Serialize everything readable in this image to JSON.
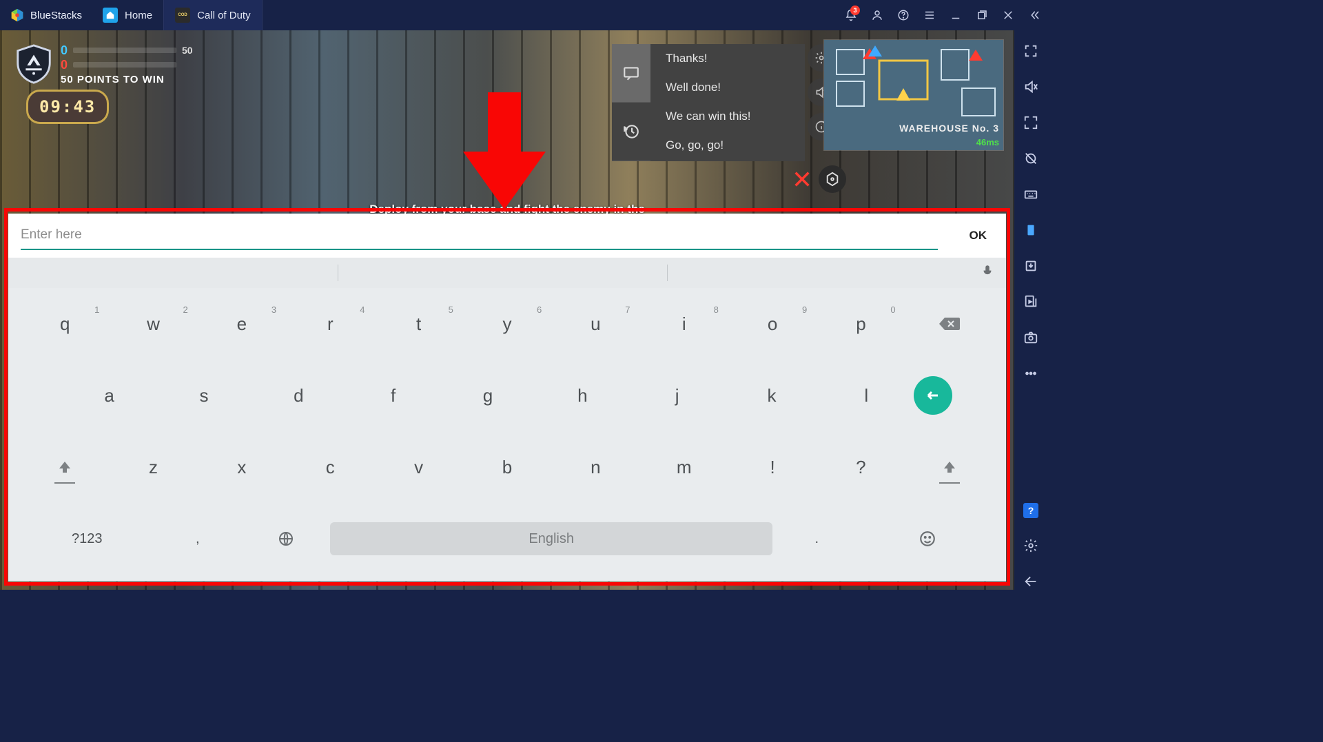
{
  "brand": "BlueStacks",
  "tabs": {
    "home": "Home",
    "cod": "Call of Duty"
  },
  "notif_count": "3",
  "hud": {
    "score_blue": "0",
    "score_red": "0",
    "target": "50",
    "objective": "50 POINTS TO WIN",
    "timer": "09:43",
    "deploy_hint": "Deploy from your base and fight the enemy in the",
    "map_location": "WAREHOUSE No. 3",
    "ping": "46ms"
  },
  "quickchat": [
    "Thanks!",
    "Well done!",
    "We can win this!",
    "Go, go, go!"
  ],
  "input": {
    "placeholder": "Enter here",
    "ok": "OK"
  },
  "keyboard": {
    "row1": [
      {
        "k": "q",
        "h": "1"
      },
      {
        "k": "w",
        "h": "2"
      },
      {
        "k": "e",
        "h": "3"
      },
      {
        "k": "r",
        "h": "4"
      },
      {
        "k": "t",
        "h": "5"
      },
      {
        "k": "y",
        "h": "6"
      },
      {
        "k": "u",
        "h": "7"
      },
      {
        "k": "i",
        "h": "8"
      },
      {
        "k": "o",
        "h": "9"
      },
      {
        "k": "p",
        "h": "0"
      }
    ],
    "row2": [
      "a",
      "s",
      "d",
      "f",
      "g",
      "h",
      "j",
      "k",
      "l"
    ],
    "row3": [
      "z",
      "x",
      "c",
      "v",
      "b",
      "n",
      "m",
      "!",
      "?"
    ],
    "sym_label": "?123",
    "space_label": "English",
    "comma": ",",
    "period": "."
  }
}
